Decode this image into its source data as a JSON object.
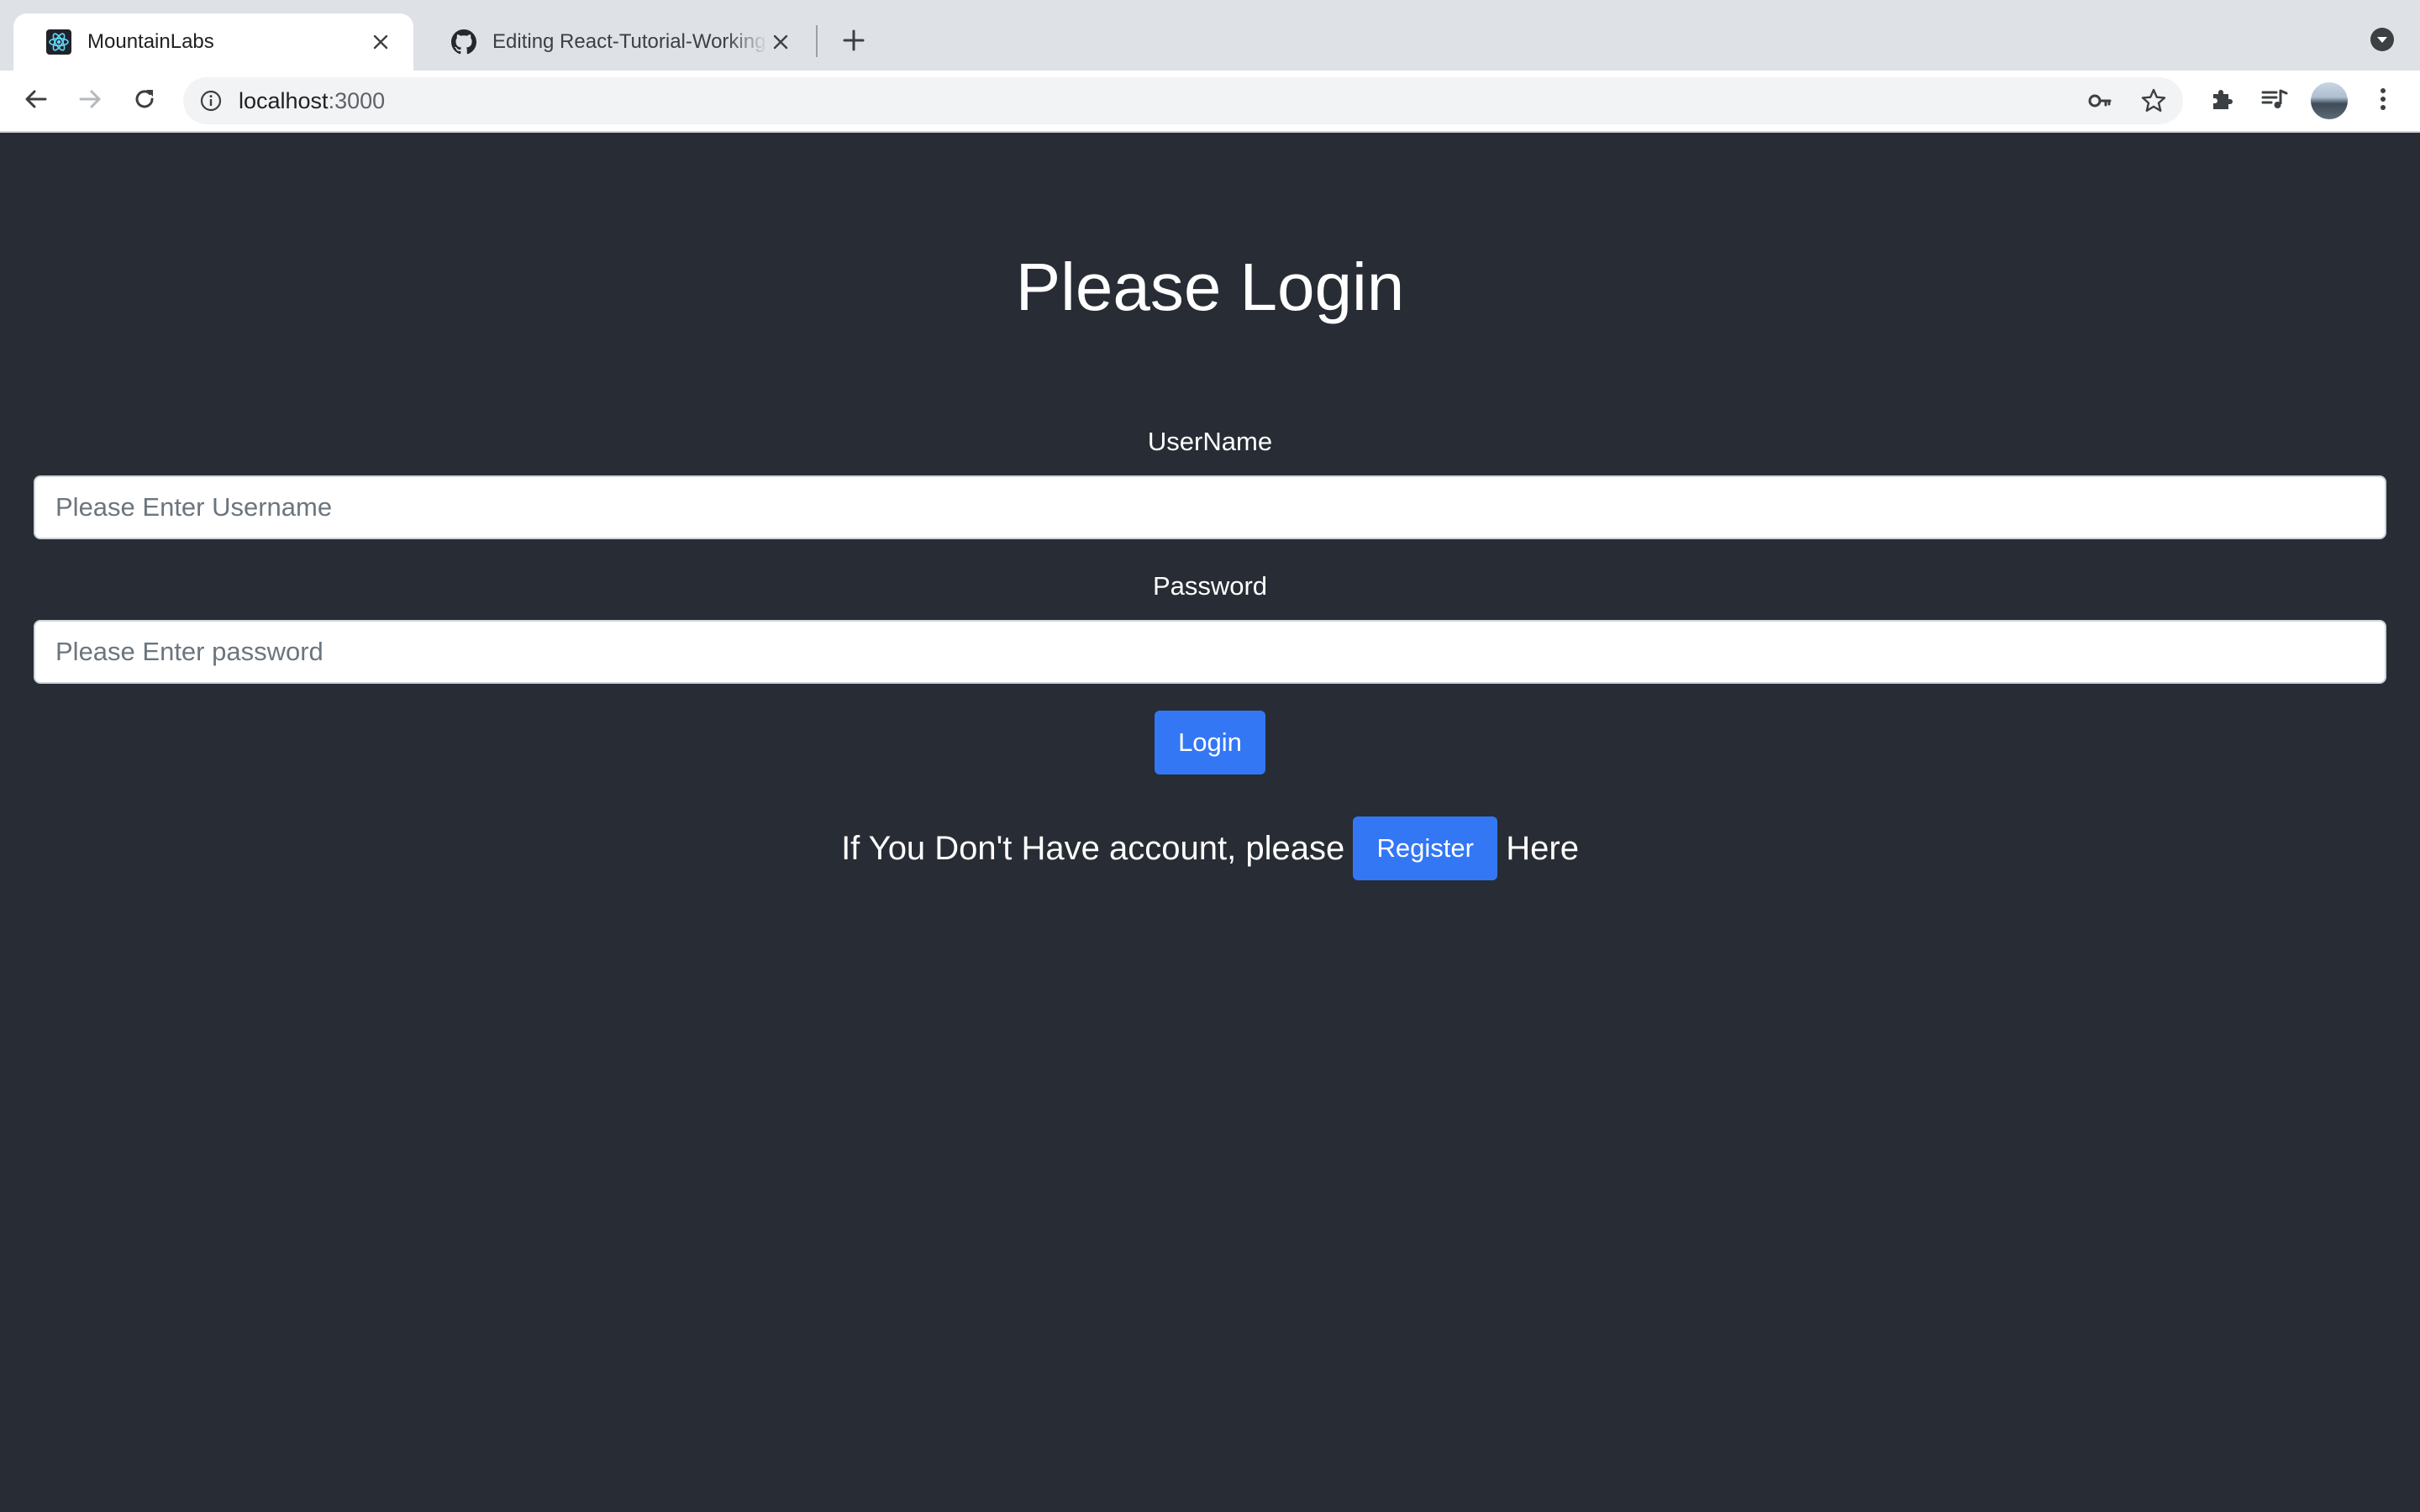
{
  "browser": {
    "tabs": [
      {
        "title": "MountainLabs",
        "active": true,
        "favicon": "react-logo-icon"
      },
      {
        "title": "Editing React-Tutorial-Working",
        "active": false,
        "favicon": "github-icon"
      }
    ],
    "address_bar": {
      "host": "localhost",
      "port": ":3000"
    }
  },
  "page": {
    "title": "Please Login",
    "username": {
      "label": "UserName",
      "placeholder": "Please Enter Username",
      "value": ""
    },
    "password": {
      "label": "Password",
      "placeholder": "Please Enter password",
      "value": ""
    },
    "login_button": "Login",
    "register_prompt": {
      "before": "If You Don't Have account, please",
      "button": "Register",
      "after": "Here"
    }
  },
  "colors": {
    "page_background": "#282c34",
    "primary_button": "#3377f5",
    "tab_strip": "#dee1e6"
  }
}
